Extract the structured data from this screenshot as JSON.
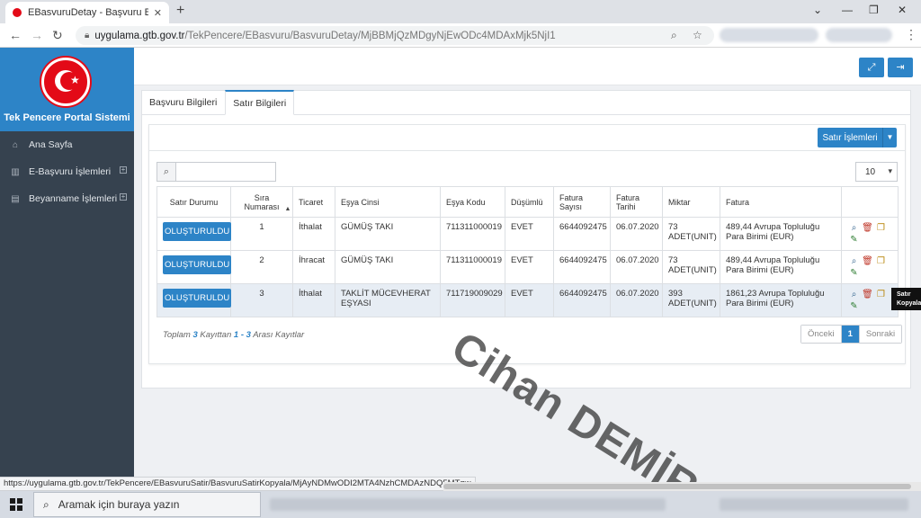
{
  "browser": {
    "tab_title": "EBasvuruDetay - Başvuru Bilgi Sis",
    "tab_close": "✕",
    "new_tab": "+",
    "url_host": "uygulama.gtb.gov.tr",
    "url_path": "/TekPencere/EBasvuru/BasvuruDetay/MjBBMjQzMDgyNjEwODc4MDAxMjk5NjI1",
    "status_url": "https://uygulama.gtb.gov.tr/TekPencere/EBasvuruSatir/BasvuruSatirKopyala/MjAyNDMwODI2MTA4NzhCMDAzNDQ5MTgw"
  },
  "sidebar": {
    "brand_title": "Tek Pencere Portal Sistemi",
    "items": [
      {
        "label": "Ana Sayfa"
      },
      {
        "label": "E-Başvuru İşlemleri"
      },
      {
        "label": "Beyanname İşlemleri"
      }
    ]
  },
  "tabs": [
    {
      "label": "Başvuru Bilgileri"
    },
    {
      "label": "Satır Bilgileri"
    }
  ],
  "toolbar": {
    "satir_islemleri": "Satır İşlemleri",
    "page_size": "10"
  },
  "table": {
    "columns": [
      "Satır Durumu",
      "Sıra Numarası",
      "Ticaret",
      "Eşya Cinsi",
      "Eşya Kodu",
      "Düşümlü",
      "Fatura Sayısı",
      "Fatura Tarihi",
      "Miktar",
      "Fatura"
    ],
    "rows": [
      {
        "status": "OLUŞTURULDU",
        "sira": "1",
        "ticaret": "İthalat",
        "esya_cinsi": "GÜMÜŞ TAKI",
        "esya_kodu": "711311000019",
        "dusumlu": "EVET",
        "fatura_sayisi": "6644092475",
        "fatura_tarihi": "06.07.2020",
        "miktar": "73 ADET(UNIT)",
        "fatura": "489,44 Avrupa Topluluğu Para Birimi (EUR)"
      },
      {
        "status": "OLUŞTURULDU",
        "sira": "2",
        "ticaret": "İhracat",
        "esya_cinsi": "GÜMÜŞ TAKI",
        "esya_kodu": "711311000019",
        "dusumlu": "EVET",
        "fatura_sayisi": "6644092475",
        "fatura_tarihi": "06.07.2020",
        "miktar": "73 ADET(UNIT)",
        "fatura": "489,44 Avrupa Topluluğu Para Birimi (EUR)"
      },
      {
        "status": "OLUŞTURULDU",
        "sira": "3",
        "ticaret": "İthalat",
        "esya_cinsi": "TAKLİT MÜCEVHERAT EŞYASI",
        "esya_kodu": "711719009029",
        "dusumlu": "EVET",
        "fatura_sayisi": "6644092475",
        "fatura_tarihi": "06.07.2020",
        "miktar": "393 ADET(UNIT)",
        "fatura": "1861,23 Avrupa Topluluğu Para Birimi (EUR)"
      }
    ]
  },
  "tooltip": {
    "line1": "Satır",
    "line2": "Kopyala"
  },
  "footer": {
    "info_pre": "Toplam ",
    "total": "3",
    "info_mid": " Kayıttan ",
    "range": "1 - 3",
    "info_post": " Arası Kayıtlar"
  },
  "pagination": {
    "prev": "Önceki",
    "current": "1",
    "next": "Sonraki"
  },
  "watermark": "Cihan DEMİR",
  "taskbar": {
    "search_placeholder": "Aramak için buraya yazın"
  },
  "icons": {
    "zoom": "search-icon",
    "delete": "trash-icon",
    "copy": "copy-icon",
    "edit": "edit-icon",
    "fullscreen": "expand-icon",
    "logout": "logout-icon"
  },
  "colors": {
    "primary": "#2d84c7",
    "sidebar": "#36424f",
    "danger": "#c0392b"
  }
}
